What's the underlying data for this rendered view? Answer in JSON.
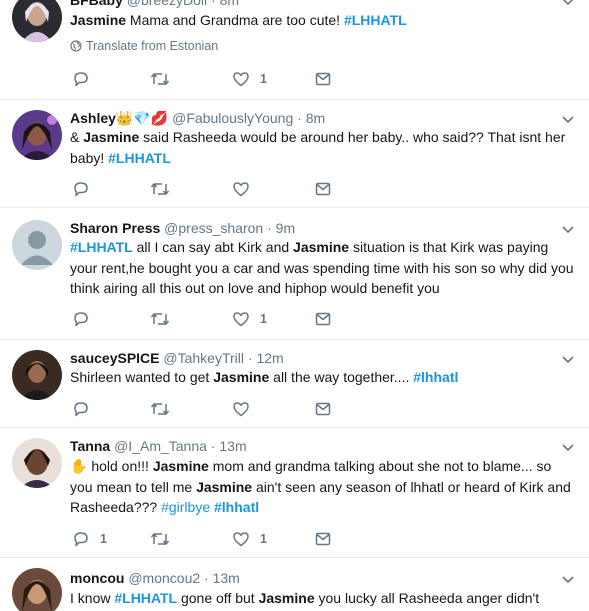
{
  "tweets": [
    {
      "display_name": "BFBaby",
      "handle": "@breezyDoll",
      "sep": "·",
      "time": "8m",
      "segments": [
        {
          "t": "b",
          "v": "Jasmine"
        },
        {
          "t": "n",
          "v": " Mama and Grandma are too cute! "
        },
        {
          "t": "hb",
          "v": "#LHHATL"
        }
      ],
      "translate": "Translate from Estonian",
      "reply_count": "",
      "retweet_count": "",
      "like_count": "1",
      "avatar_color": "#2b2b33"
    },
    {
      "display_name": "Ashley",
      "name_emoji": [
        "👑",
        "💎",
        "💋"
      ],
      "handle": "@FabulouslyYoung",
      "sep": "·",
      "time": "8m",
      "segments": [
        {
          "t": "n",
          "v": "& "
        },
        {
          "t": "b",
          "v": "Jasmine"
        },
        {
          "t": "n",
          "v": " said Rasheeda would be around her baby.. who said?? That isnt her baby! "
        },
        {
          "t": "hb",
          "v": "#LHHATL"
        }
      ],
      "reply_count": "",
      "retweet_count": "",
      "like_count": "",
      "avatar_color": "#5a3a8a"
    },
    {
      "display_name": "Sharon Press",
      "handle": "@press_sharon",
      "sep": "·",
      "time": "9m",
      "segments": [
        {
          "t": "hb",
          "v": "#LHHATL"
        },
        {
          "t": "n",
          "v": " all I can say abt Kirk and "
        },
        {
          "t": "b",
          "v": "Jasmine"
        },
        {
          "t": "n",
          "v": " situation is that Kirk was paying your rent,he bought you a car and was spending time with his son so why did you think airing all this out on love and hiphop would benefit you"
        }
      ],
      "reply_count": "",
      "retweet_count": "",
      "like_count": "1",
      "avatar_color": "#ccd6dd"
    },
    {
      "display_name": "sauceySPICE",
      "handle": "@TahkeyTrill",
      "sep": "·",
      "time": "12m",
      "segments": [
        {
          "t": "n",
          "v": "Shirleen wanted to get "
        },
        {
          "t": "b",
          "v": "Jasmine"
        },
        {
          "t": "n",
          "v": " all the way together.... "
        },
        {
          "t": "hb",
          "v": "#lhhatl"
        }
      ],
      "reply_count": "",
      "retweet_count": "",
      "like_count": "",
      "avatar_color": "#3a2a22"
    },
    {
      "display_name": "Tanna",
      "handle": "@I_Am_Tanna",
      "sep": "·",
      "time": "13m",
      "segments": [
        {
          "t": "n",
          "v": "✋ hold on!!! "
        },
        {
          "t": "b",
          "v": "Jasmine"
        },
        {
          "t": "n",
          "v": " mom and grandma talking about she not to blame... so you mean to tell me "
        },
        {
          "t": "b",
          "v": "Jasmine"
        },
        {
          "t": "n",
          "v": " ain't seen any season of lhhatl or heard of Kirk and Rasheeda??? "
        },
        {
          "t": "h",
          "v": "#girlbye"
        },
        {
          "t": "n",
          "v": " "
        },
        {
          "t": "hb",
          "v": "#lhhatl"
        }
      ],
      "reply_count": "1",
      "retweet_count": "",
      "like_count": "1",
      "avatar_color": "#4a3a30"
    },
    {
      "display_name": "moncou",
      "handle": "@moncou2",
      "sep": "·",
      "time": "13m",
      "segments": [
        {
          "t": "n",
          "v": "I know "
        },
        {
          "t": "hb",
          "v": "#LHHATL"
        },
        {
          "t": "n",
          "v": " gone off but "
        },
        {
          "t": "b",
          "v": "Jasmine"
        },
        {
          "t": "n",
          "v": " you lucky all Rasheeda anger didn't come"
        }
      ],
      "reply_count": "",
      "retweet_count": "",
      "like_count": "",
      "avatar_color": "#6a4a3a"
    }
  ],
  "icons": {
    "reply": "reply-icon",
    "retweet": "retweet-icon",
    "like": "like-icon",
    "dm": "direct-message-icon",
    "globe": "globe-icon",
    "caret": "chevron-down-icon"
  },
  "colors": {
    "link": "#1b95e0",
    "muted": "#657786",
    "text": "#14171a",
    "border": "#e6ecf0"
  }
}
